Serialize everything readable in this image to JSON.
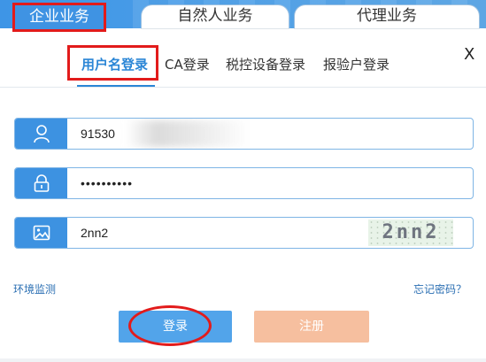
{
  "tabs": {
    "enterprise": "企业业务",
    "personal": "自然人业务",
    "agent": "代理业务"
  },
  "close_label": "X",
  "login_types": [
    {
      "label": "用户名登录",
      "active": true
    },
    {
      "label": "CA登录",
      "active": false
    },
    {
      "label": "税控设备登录",
      "active": false
    },
    {
      "label": "报验户登录",
      "active": false
    }
  ],
  "form": {
    "username_value": "91530",
    "password_value": "••••••••••",
    "captcha_value": "2nn2",
    "captcha_image_text": "2nn2"
  },
  "links": {
    "env_check": "环境监测",
    "forgot_password": "忘记密码？"
  },
  "buttons": {
    "login": "登录",
    "register": "注册"
  },
  "icons": [
    "user-icon",
    "lock-icon",
    "image-icon"
  ],
  "colors": {
    "primary": "#3d92e1",
    "login_button": "#52a4ea",
    "register_button": "#f6bf9f",
    "annotation_red": "#e21b1b"
  }
}
